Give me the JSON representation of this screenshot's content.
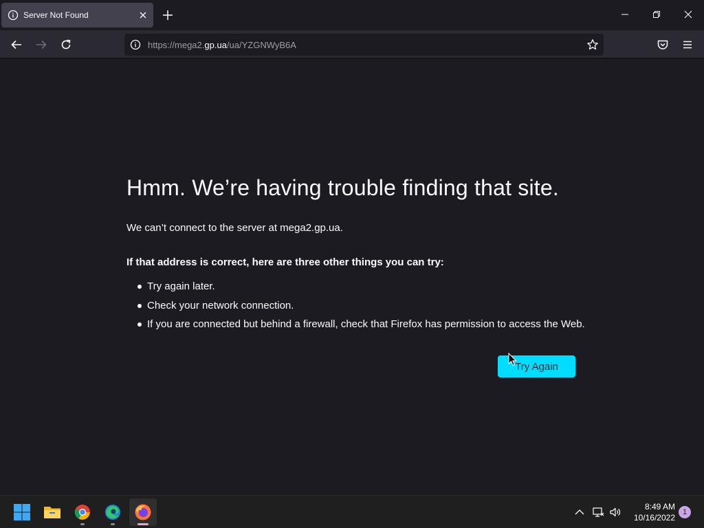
{
  "browser": {
    "tab": {
      "title": "Server Not Found",
      "icon": "info-icon"
    },
    "url": {
      "scheme_prefix": "https://mega2.",
      "host": "gp.ua",
      "path": "/ua/YZGNWyB6A"
    }
  },
  "error_page": {
    "title": "Hmm. We’re having trouble finding that site.",
    "description": "We can’t connect to the server at mega2.gp.ua.",
    "suggestions_title": "If that address is correct, here are three other things you can try:",
    "suggestions": [
      "Try again later.",
      "Check your network connection.",
      "If you are connected but behind a firewall, check that Firefox has permission to access the Web."
    ],
    "try_again_label": "Try Again",
    "accent_color": "#00ddff"
  },
  "taskbar": {
    "apps": [
      "windows-start",
      "file-explorer",
      "chrome",
      "edge",
      "firefox"
    ],
    "time": "8:49 AM",
    "date": "10/16/2022",
    "notification_count": "1"
  }
}
